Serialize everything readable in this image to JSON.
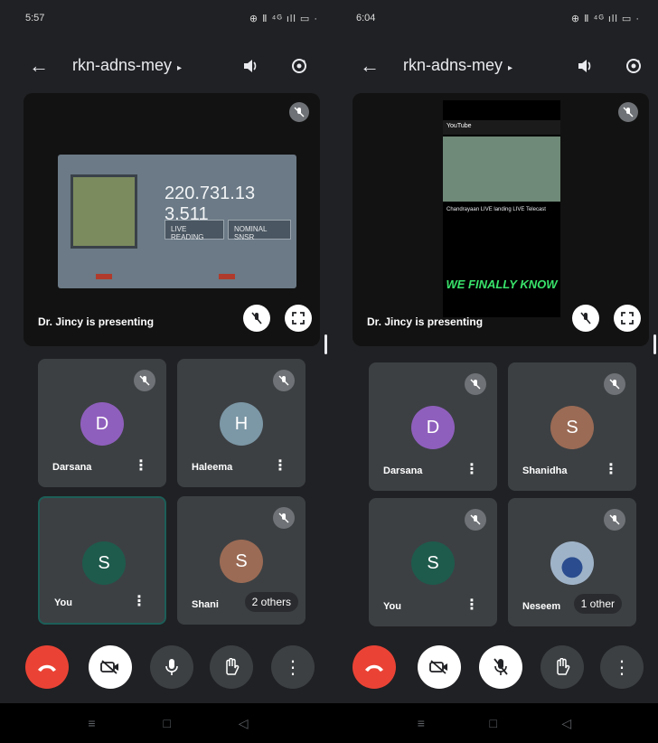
{
  "screens": [
    {
      "status": {
        "time": "5:57",
        "icons_left": "⊙ ● ▣ ᗰ",
        "icons_right": "⊕ Ⅱ ⁴ᴳ ıll ▭ ·"
      },
      "meeting": {
        "code": "rkn-adns-mey",
        "caret": "▸"
      },
      "presentation": {
        "presenter_text": "Dr. Jincy  is presenting",
        "shared_screen": {
          "reading_1": "220.731.13",
          "reading_2": "3.511",
          "label_1": "LIVE READING",
          "label_2": "NOMINAL SNSR"
        }
      },
      "participants": [
        {
          "name": "Darsana",
          "initial": "D",
          "color": "#8f5fbd"
        },
        {
          "name": "Haleema",
          "initial": "H",
          "color": "#7c97a6"
        },
        {
          "name": "You",
          "initial": "S",
          "color": "#1e5b4d"
        },
        {
          "name": "Shani",
          "initial": "S",
          "color": "#9b6b55",
          "overlay": "2 others"
        }
      ]
    },
    {
      "status": {
        "time": "6:04",
        "icons_left": "⊙ ● ▣ ᗰ",
        "icons_right": "⊕ Ⅱ ⁴ᴳ ıll ▭ ·"
      },
      "meeting": {
        "code": "rkn-adns-mey",
        "caret": "▸"
      },
      "presentation": {
        "presenter_text": "Dr. Jincy  is presenting",
        "shared_screen": {
          "app_bar": "YouTube",
          "overlay_text": "WE FINALLY KNOW",
          "video_title": "Chandrayaan LIVE landing LIVE Telecast"
        }
      },
      "participants": [
        {
          "name": "Darsana",
          "initial": "D",
          "color": "#8f5fbd"
        },
        {
          "name": "Shanidha",
          "initial": "S",
          "color": "#9b6b55"
        },
        {
          "name": "You",
          "initial": "S",
          "color": "#1e5b4d"
        },
        {
          "name": "Neseem",
          "initial": "",
          "color": "photo",
          "overlay": "1 other"
        }
      ]
    }
  ],
  "controls": {
    "end_call_icon": "phone-end-icon",
    "camera_icon": "camera-off-icon",
    "mic_icon": "mic-icon",
    "raise_hand_icon": "hand-icon",
    "more_icon": "more-vert-icon"
  },
  "glyphs": {
    "back": "←",
    "more": "⋮",
    "mic_off": "⦸",
    "speaker": "🔊",
    "switch_camera": "⟳"
  },
  "colors": {
    "background": "#202124",
    "tile": "#3c4043",
    "end_call": "#ea4335"
  }
}
